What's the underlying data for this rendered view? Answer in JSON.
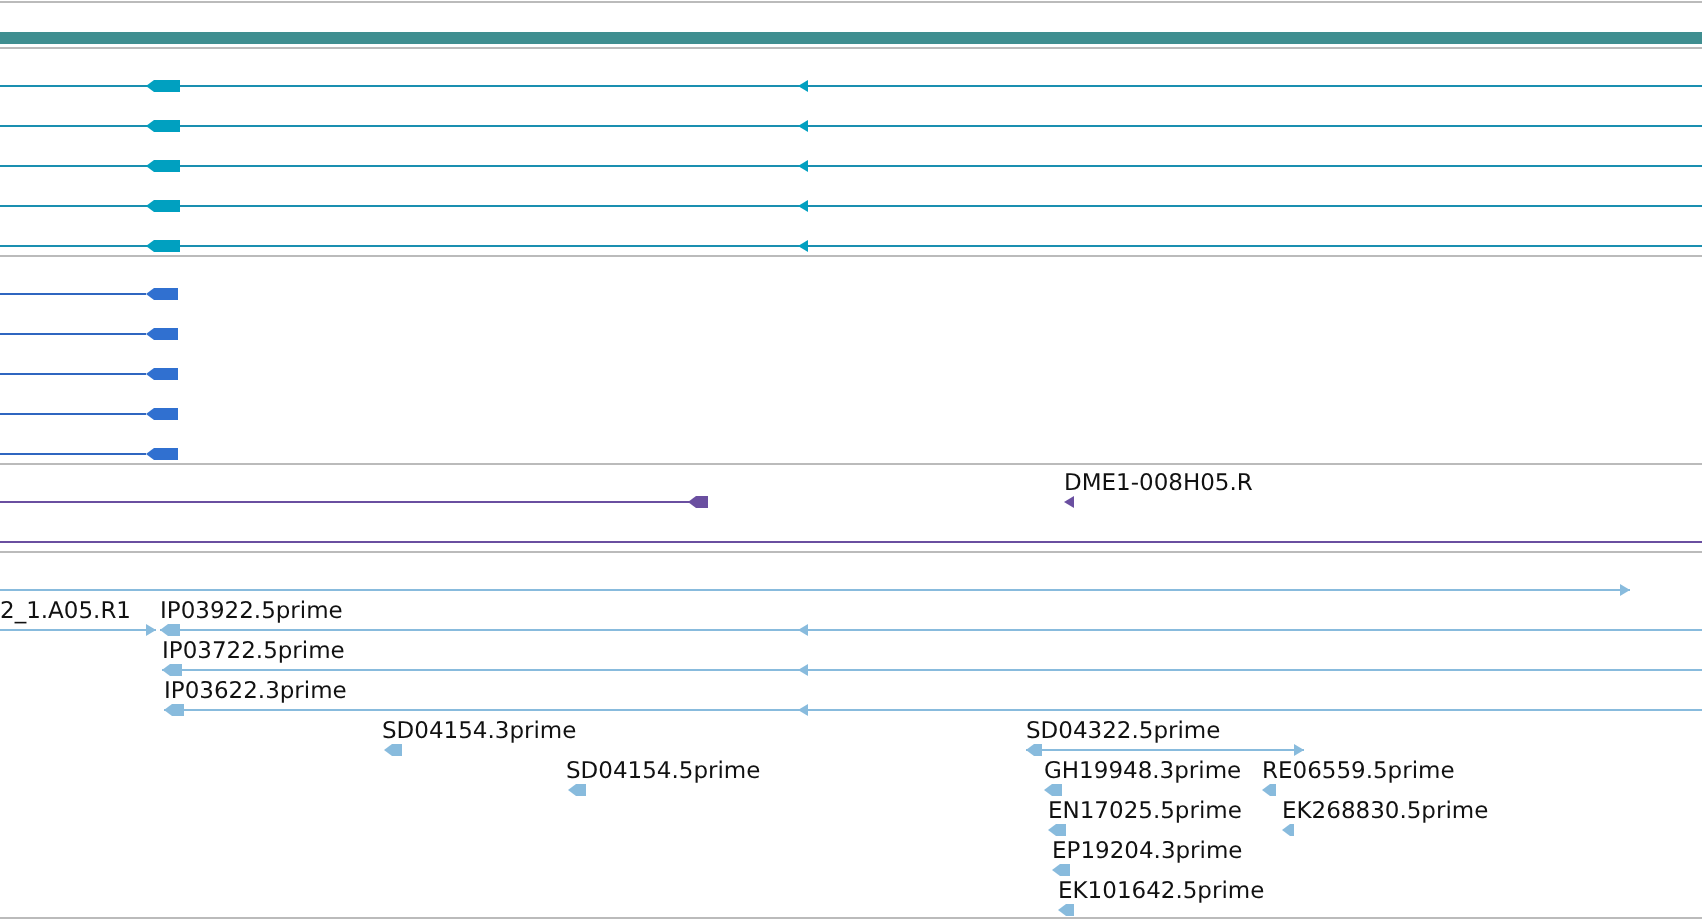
{
  "tracks": [
    {
      "kind": "band"
    },
    {
      "kind": "transcripts"
    },
    {
      "kind": "cds"
    },
    {
      "kind": "cdna",
      "labels": [
        "DME1-008H05.R"
      ]
    },
    {
      "kind": "est",
      "labels": [
        "2_1.A05.R1",
        "IP03922.5prime",
        "IP03722.5prime",
        "IP03622.3prime",
        "SD04154.3prime",
        "SD04154.5prime",
        "SD04322.5prime",
        "GH19948.3prime",
        "RE06559.5prime",
        "EN17025.5prime",
        "EK268830.5prime",
        "EP19204.3prime",
        "EK101642.5prime"
      ]
    }
  ]
}
